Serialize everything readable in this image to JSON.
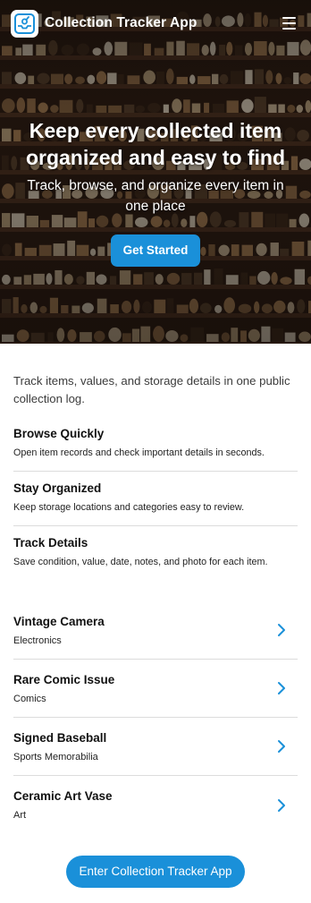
{
  "header": {
    "app_title": "Collection Tracker App",
    "logo_icon": "collection-box-icon",
    "menu_icon": "hamburger-menu-icon"
  },
  "hero": {
    "heading": "Keep every collected item organized and easy to find",
    "subheading": "Track, browse, and organize every item in one place",
    "button_label": "Get Started"
  },
  "intro": "Track items, values, and storage details in one public collection log.",
  "features": [
    {
      "title": "Browse Quickly",
      "description": "Open item records and check important details in seconds."
    },
    {
      "title": "Stay Organized",
      "description": "Keep storage locations and categories easy to review."
    },
    {
      "title": "Track Details",
      "description": "Save condition, value, date, notes, and photo for each item."
    }
  ],
  "items": [
    {
      "name": "Vintage Camera",
      "category": "Electronics"
    },
    {
      "name": "Rare Comic Issue",
      "category": "Comics"
    },
    {
      "name": "Signed Baseball",
      "category": "Sports Memorabilia"
    },
    {
      "name": "Ceramic Art Vase",
      "category": "Art"
    }
  ],
  "cta": {
    "label": "Enter Collection Tracker App"
  },
  "colors": {
    "accent": "#1a90d9",
    "hero_overlay": "#1d130d",
    "divider": "#dcdcdc"
  }
}
